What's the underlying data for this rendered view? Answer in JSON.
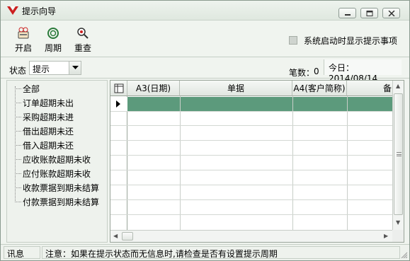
{
  "window": {
    "title": "提示向导"
  },
  "toolbar": {
    "open_label": "开启",
    "period_label": "周期",
    "check_label": "重查",
    "startup_option_label": "系统启动时显示提示事项",
    "startup_option_checked": false
  },
  "status": {
    "state_label": "状态",
    "state_value": "提示",
    "count_label": "笔数：",
    "count_value": "0",
    "today_text": "今日：2014/08/14"
  },
  "tree": {
    "items": [
      "全部",
      "订单超期未出",
      "采购超期未进",
      "借出超期未还",
      "借入超期未还",
      "应收账款超期未收",
      "应付账款超期未收",
      "收款票据到期未结算",
      "付款票据到期未结算"
    ]
  },
  "grid": {
    "columns": [
      "A3(日期)",
      "单据",
      "A4(客户简称)",
      "备"
    ]
  },
  "statusbar": {
    "label": "讯息",
    "message": "注意：如果在提示状态而无信息时,请检查是否有设置提示周期"
  },
  "colors": {
    "selected_row": "#5c9a7c",
    "brand_red": "#cc1f1f"
  }
}
